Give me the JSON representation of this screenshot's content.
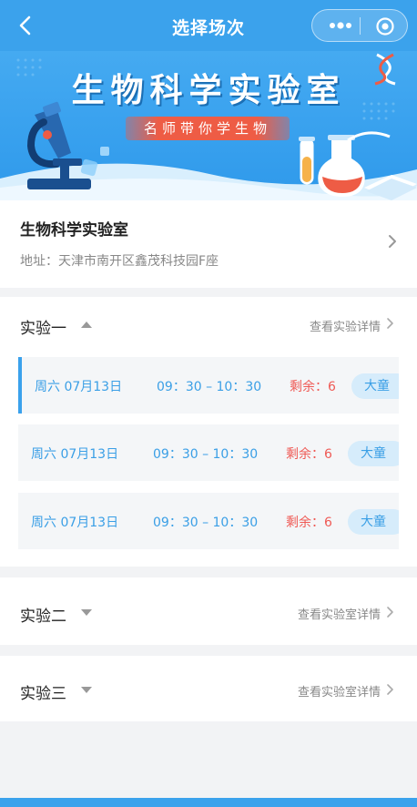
{
  "header": {
    "title": "选择场次",
    "back_icon": "chevron-left-icon",
    "more_icon": "more-dots-icon",
    "close_icon": "target-circle-icon",
    "color": "#3ba2ec"
  },
  "banner": {
    "title": "生物科学实验室",
    "subtitle": "名师带你学生物"
  },
  "lab": {
    "name": "生物科学实验室",
    "address": "地址：天津市南开区鑫茂科技园F座"
  },
  "sections": [
    {
      "title": "实验一",
      "link": "查看实验详情",
      "expanded": true,
      "slots": [
        {
          "day": "周六  07月13日",
          "time": "09：30 – 10：30",
          "remain": "剩余：6",
          "tag": "大童"
        },
        {
          "day": "周六  07月13日",
          "time": "09：30 – 10：30",
          "remain": "剩余：6",
          "tag": "大童"
        },
        {
          "day": "周六  07月13日",
          "time": "09：30 – 10：30",
          "remain": "剩余：6",
          "tag": "大童"
        }
      ]
    },
    {
      "title": "实验二",
      "link": "查看实验室详情",
      "expanded": false
    },
    {
      "title": "实验三",
      "link": "查看实验室详情",
      "expanded": false
    }
  ],
  "colors": {
    "accent": "#3aa1ec",
    "remain": "#ef5a55",
    "tag_bg": "#d6ecfb"
  }
}
